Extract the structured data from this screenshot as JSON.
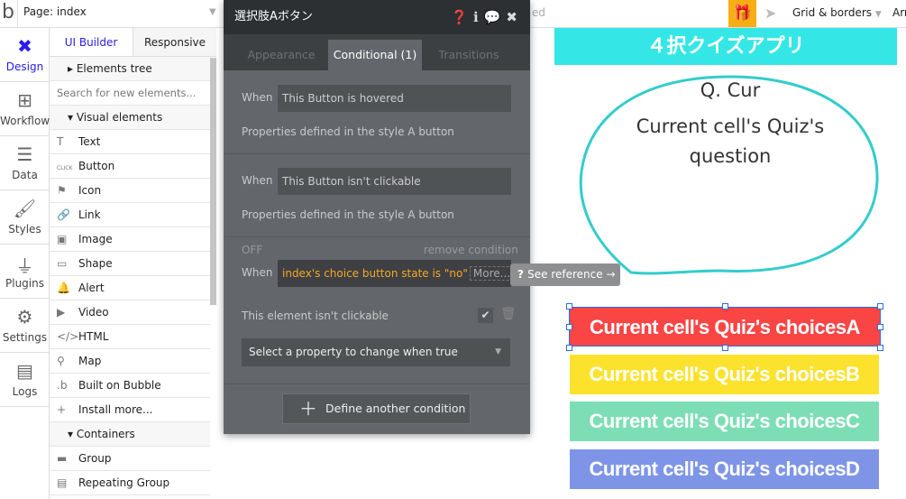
{
  "topbar": {
    "logo": "b",
    "page": "Page: index",
    "saved_hint": "ed",
    "grid": "Grid & borders",
    "arrange": "Arr"
  },
  "nav": [
    {
      "label": "Design",
      "icon": "design-icon"
    },
    {
      "label": "Workflow",
      "icon": "workflow-icon"
    },
    {
      "label": "Data",
      "icon": "database-icon"
    },
    {
      "label": "Styles",
      "icon": "brush-icon"
    },
    {
      "label": "Plugins",
      "icon": "plug-icon"
    },
    {
      "label": "Settings",
      "icon": "gear-icon"
    },
    {
      "label": "Logs",
      "icon": "document-icon"
    }
  ],
  "panel": {
    "tabs": [
      "UI Builder",
      "Responsive"
    ],
    "elements_tree": "Elements tree",
    "search_placeholder": "Search for new elements...",
    "visual_header": "Visual elements",
    "visual": [
      {
        "label": "Text",
        "icon": "T"
      },
      {
        "label": "Button",
        "icon": "CLICK"
      },
      {
        "label": "Icon",
        "icon": "⚑"
      },
      {
        "label": "Link",
        "icon": "🔗"
      },
      {
        "label": "Image",
        "icon": "▣"
      },
      {
        "label": "Shape",
        "icon": "▭"
      },
      {
        "label": "Alert",
        "icon": "🔔"
      },
      {
        "label": "Video",
        "icon": "▶"
      },
      {
        "label": "HTML",
        "icon": "</>"
      },
      {
        "label": "Map",
        "icon": "⚲"
      },
      {
        "label": "Built on Bubble",
        "icon": ".b"
      },
      {
        "label": "Install more...",
        "icon": "+"
      }
    ],
    "containers_header": "Containers",
    "containers": [
      {
        "label": "Group",
        "icon": "▬"
      },
      {
        "label": "Repeating Group",
        "icon": "▤"
      }
    ]
  },
  "modal": {
    "title": "選択肢Aボタン",
    "tabs": [
      "Appearance",
      "Conditional (1)",
      "Transitions"
    ],
    "active_tab": "Conditional (1)",
    "when": "When",
    "c1": {
      "field": "This Button is hovered",
      "note": "Properties defined in the style A button"
    },
    "c2": {
      "field": "This Button isn't clickable",
      "note": "Properties defined in the style A button"
    },
    "c3": {
      "off": "OFF",
      "remove": "remove condition",
      "expr": "index's choice button state is \"no\"",
      "more": "More...",
      "prop": "This element isn't clickable",
      "select": "Select a property to change when true"
    },
    "define": "Define another condition"
  },
  "reference": "See reference →",
  "canvas": {
    "title": "４択クイズアプリ",
    "q_prefix": "Q. Cur",
    "question_line1": "Current cell's Quiz's",
    "question_line2": "question",
    "choices": [
      {
        "label": "Current cell's Quiz's choicesA",
        "color": "#fa4545"
      },
      {
        "label": "Current cell's Quiz's choicesB",
        "color": "#fce22d"
      },
      {
        "label": "Current cell's Quiz's choicesC",
        "color": "#7ddeb5"
      },
      {
        "label": "Current cell's Quiz's choicesD",
        "color": "#7e95e7"
      }
    ]
  }
}
